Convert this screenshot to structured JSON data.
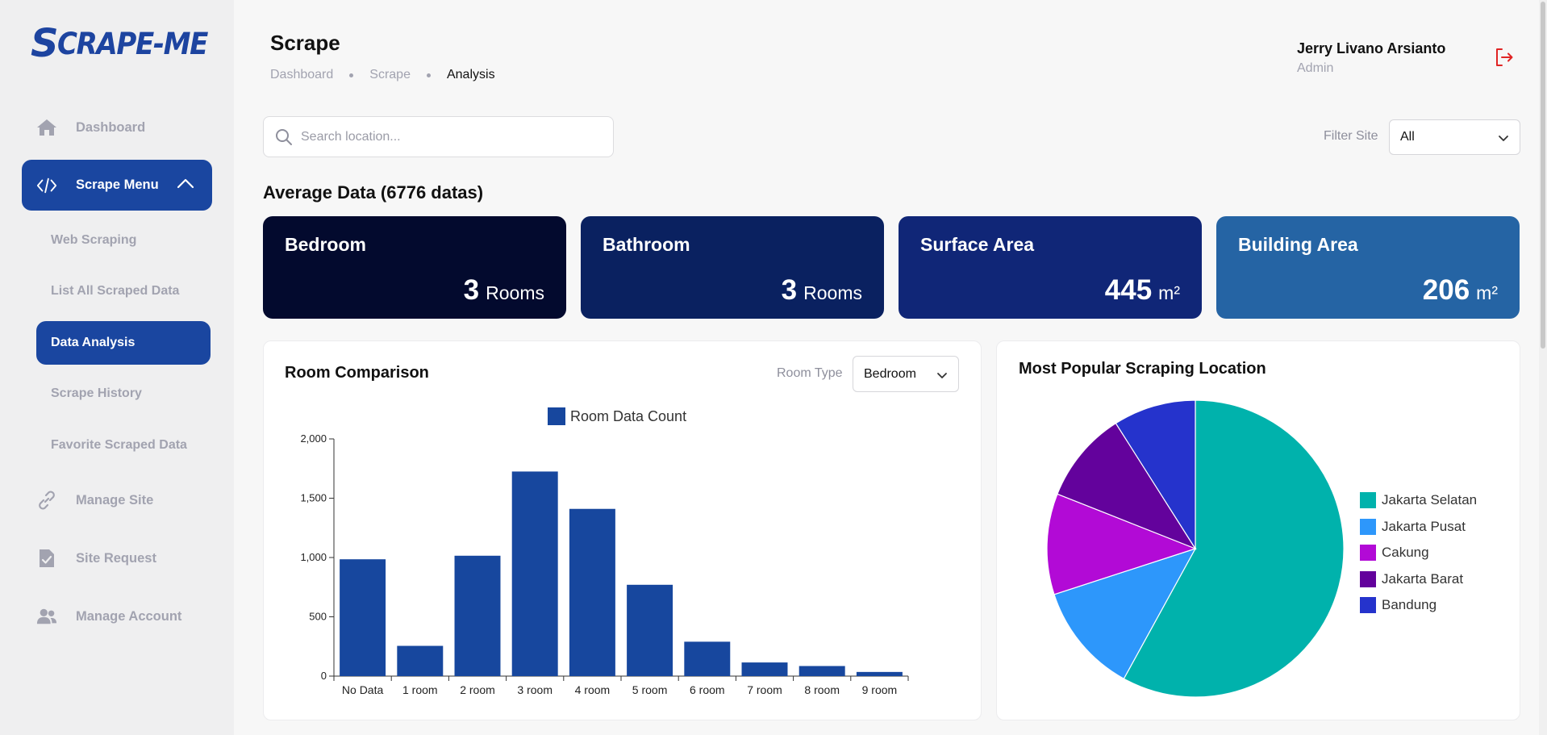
{
  "app": {
    "logo_s": "S",
    "logo_text": "CRAPE-ME"
  },
  "sidebar": {
    "dashboard": "Dashboard",
    "scrape_menu": "Scrape Menu",
    "sub_items": [
      "Web Scraping",
      "List All Scraped Data",
      "Data Analysis",
      "Scrape History",
      "Favorite Scraped Data"
    ],
    "manage_site": "Manage Site",
    "site_request": "Site Request",
    "manage_account": "Manage Account"
  },
  "header": {
    "title": "Scrape",
    "breadcrumb": [
      "Dashboard",
      "Scrape",
      "Analysis"
    ],
    "user_name": "Jerry Livano Arsianto",
    "user_role": "Admin"
  },
  "search": {
    "placeholder": "Search location..."
  },
  "filter": {
    "label": "Filter Site",
    "value": "All"
  },
  "average": {
    "title": "Average Data (6776 datas)",
    "cards": [
      {
        "title": "Bedroom",
        "value": "3",
        "unit": "Rooms",
        "color": "#030a2e"
      },
      {
        "title": "Bathroom",
        "value": "3",
        "unit": "Rooms",
        "color": "#0a2160"
      },
      {
        "title": "Surface Area",
        "value": "445",
        "unit": "m²",
        "color": "#102677"
      },
      {
        "title": "Building Area",
        "value": "206",
        "unit": "m²",
        "color": "#2564a4"
      }
    ]
  },
  "room_comparison": {
    "title": "Room Comparison",
    "room_type_label": "Room Type",
    "room_type_value": "Bedroom"
  },
  "popular_location": {
    "title": "Most Popular Scraping Location"
  },
  "chart_data": [
    {
      "type": "bar",
      "legend": "Room Data Count",
      "color": "#17479e",
      "categories": [
        "No Data",
        "1 room",
        "2 room",
        "3 room",
        "4 room",
        "5 room",
        "6 room",
        "7 room",
        "8 room",
        "9 room"
      ],
      "values": [
        985,
        255,
        1015,
        1725,
        1410,
        770,
        290,
        115,
        85,
        35
      ],
      "ylim": [
        0,
        2000
      ],
      "yticks": [
        "0",
        "500",
        "1,000",
        "1,500",
        "2,000"
      ]
    },
    {
      "type": "pie",
      "labels": [
        "Jakarta Selatan",
        "Jakarta Pusat",
        "Cakung",
        "Jakarta Barat",
        "Bandung"
      ],
      "values": [
        58,
        12,
        11,
        10,
        9
      ],
      "colors": [
        "#00b2ac",
        "#2d97fb",
        "#b20ad6",
        "#63029c",
        "#2533cc"
      ],
      "legend_position": "right"
    }
  ]
}
